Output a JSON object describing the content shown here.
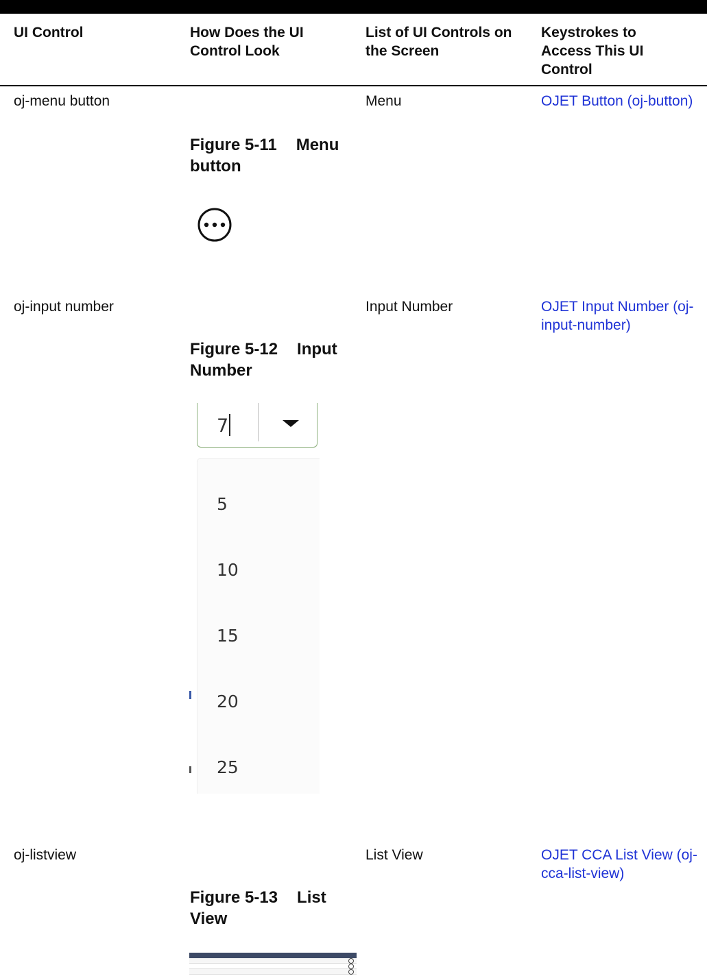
{
  "header": {
    "col1": "UI Control",
    "col2": "How Does the UI Control Look",
    "col3": "List of UI Controls on the Screen",
    "col4": "Keystrokes to Access This UI Control"
  },
  "rows": [
    {
      "control": "oj-menu button",
      "figure_num": "Figure 5-11",
      "figure_title": "Menu button",
      "screen_control": "Menu",
      "link": "OJET Button (oj-button)",
      "icon": "ellipsis-circle-icon"
    },
    {
      "control": "oj-input number",
      "figure_num": "Figure 5-12",
      "figure_title": "Input Number",
      "screen_control": "Input Number",
      "link": "OJET Input Number (oj-input-number)",
      "input_value": "7",
      "options": [
        "5",
        "10",
        "15",
        "20",
        "25"
      ]
    },
    {
      "control": "oj-listview",
      "figure_num": "Figure 5-13",
      "figure_title": "List View",
      "screen_control": "List View",
      "link": "OJET CCA List View (oj-cca-list-view)"
    }
  ],
  "colors": {
    "link": "#1f33d6",
    "header_rule": "#000000",
    "field_border": "#8db07d"
  }
}
